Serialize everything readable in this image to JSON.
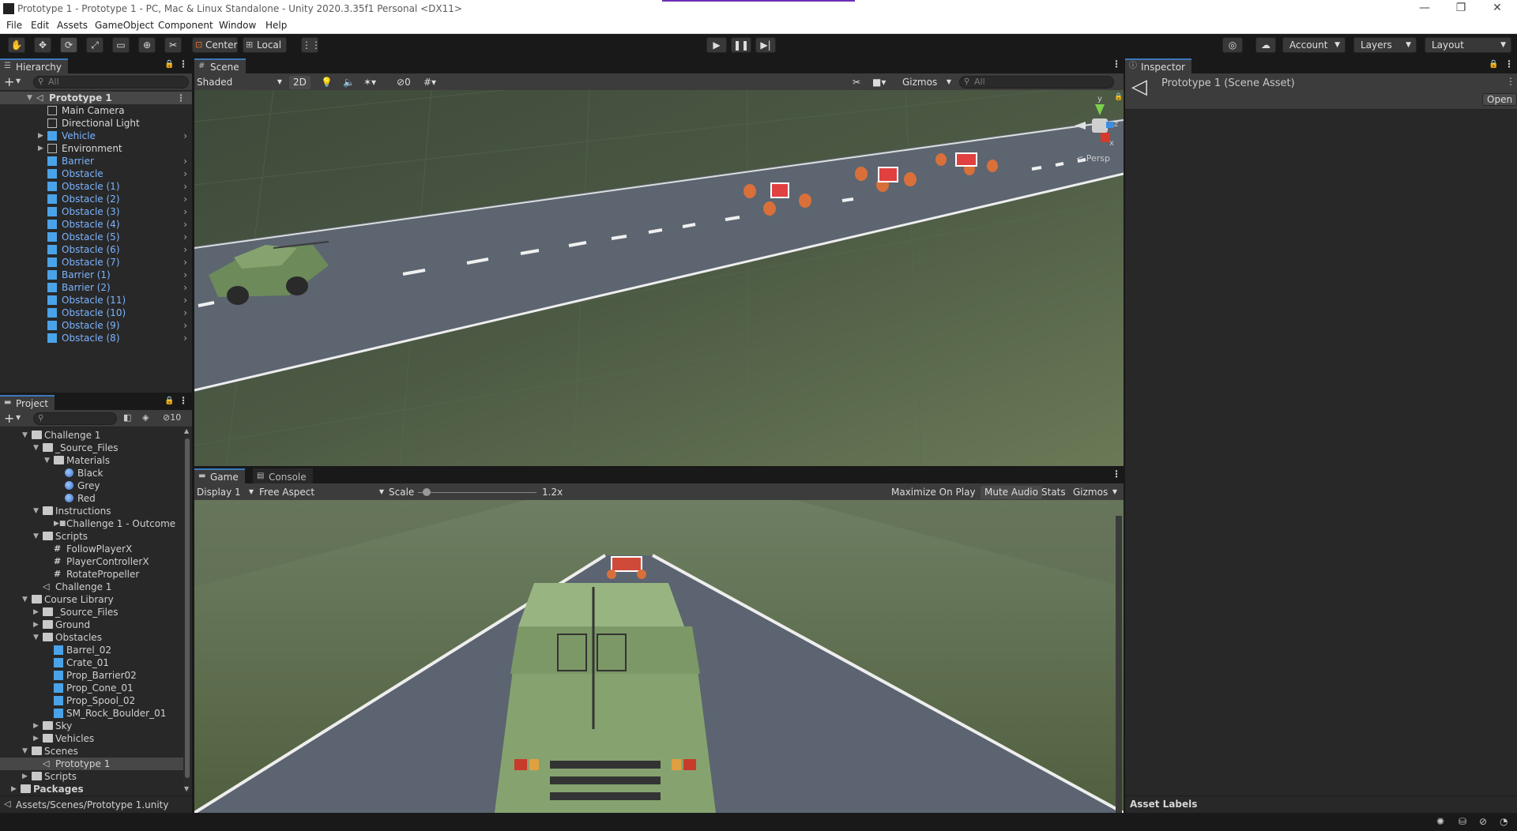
{
  "window": {
    "title": "Prototype 1 - Prototype 1 - PC, Mac & Linux Standalone - Unity 2020.3.35f1 Personal <DX11>",
    "controls": [
      "—",
      "❐",
      "✕"
    ]
  },
  "menu": [
    "File",
    "Edit",
    "Assets",
    "GameObject",
    "Component",
    "Window",
    "Help"
  ],
  "toolbar": {
    "tools": [
      "hand-tool",
      "move-tool",
      "rotate-tool",
      "scale-tool",
      "rect-tool",
      "transform-tool",
      "custom-tool"
    ],
    "pivot": "Center",
    "space": "Local",
    "account": "Account",
    "layers": "Layers",
    "layout": "Layout"
  },
  "hierarchy": {
    "tab": "Hierarchy",
    "search_placeholder": "All",
    "scene": "Prototype 1",
    "items": [
      {
        "label": "Main Camera",
        "blue": false,
        "arrow": false
      },
      {
        "label": "Directional Light",
        "blue": false,
        "arrow": false
      },
      {
        "label": "Vehicle",
        "blue": true,
        "arrow": true
      },
      {
        "label": "Environment",
        "blue": false,
        "arrow": true
      },
      {
        "label": "Barrier",
        "blue": true,
        "arrow": false
      },
      {
        "label": "Obstacle",
        "blue": true,
        "arrow": false
      },
      {
        "label": "Obstacle (1)",
        "blue": true,
        "arrow": false
      },
      {
        "label": "Obstacle (2)",
        "blue": true,
        "arrow": false
      },
      {
        "label": "Obstacle (3)",
        "blue": true,
        "arrow": false
      },
      {
        "label": "Obstacle (4)",
        "blue": true,
        "arrow": false
      },
      {
        "label": "Obstacle (5)",
        "blue": true,
        "arrow": false
      },
      {
        "label": "Obstacle (6)",
        "blue": true,
        "arrow": false
      },
      {
        "label": "Obstacle (7)",
        "blue": true,
        "arrow": false
      },
      {
        "label": "Barrier (1)",
        "blue": true,
        "arrow": false
      },
      {
        "label": "Barrier (2)",
        "blue": true,
        "arrow": false
      },
      {
        "label": "Obstacle (11)",
        "blue": true,
        "arrow": false
      },
      {
        "label": "Obstacle (10)",
        "blue": true,
        "arrow": false
      },
      {
        "label": "Obstacle (9)",
        "blue": true,
        "arrow": false
      },
      {
        "label": "Obstacle (8)",
        "blue": true,
        "arrow": false
      }
    ]
  },
  "project": {
    "tab": "Project",
    "hidden_count": "10",
    "tree": [
      {
        "label": "Challenge 1",
        "indent": 1,
        "type": "folder",
        "arrow": "down"
      },
      {
        "label": "_Source_Files",
        "indent": 2,
        "type": "folder",
        "arrow": "down"
      },
      {
        "label": "Materials",
        "indent": 3,
        "type": "folder",
        "arrow": "down"
      },
      {
        "label": "Black",
        "indent": 4,
        "type": "material",
        "arrow": ""
      },
      {
        "label": "Grey",
        "indent": 4,
        "type": "material",
        "arrow": ""
      },
      {
        "label": "Red",
        "indent": 4,
        "type": "material",
        "arrow": ""
      },
      {
        "label": "Instructions",
        "indent": 2,
        "type": "folder",
        "arrow": "down"
      },
      {
        "label": "Challenge 1 - Outcome",
        "indent": 3,
        "type": "video",
        "arrow": ""
      },
      {
        "label": "Scripts",
        "indent": 2,
        "type": "folder",
        "arrow": "down"
      },
      {
        "label": "FollowPlayerX",
        "indent": 3,
        "type": "script",
        "arrow": ""
      },
      {
        "label": "PlayerControllerX",
        "indent": 3,
        "type": "script",
        "arrow": ""
      },
      {
        "label": "RotatePropeller",
        "indent": 3,
        "type": "script",
        "arrow": ""
      },
      {
        "label": "Challenge 1",
        "indent": 2,
        "type": "scene",
        "arrow": ""
      },
      {
        "label": "Course Library",
        "indent": 1,
        "type": "folder",
        "arrow": "down"
      },
      {
        "label": "_Source_Files",
        "indent": 2,
        "type": "folder",
        "arrow": "right"
      },
      {
        "label": "Ground",
        "indent": 2,
        "type": "folder",
        "arrow": "right"
      },
      {
        "label": "Obstacles",
        "indent": 2,
        "type": "folder",
        "arrow": "down"
      },
      {
        "label": "Barrel_02",
        "indent": 3,
        "type": "prefab",
        "arrow": ""
      },
      {
        "label": "Crate_01",
        "indent": 3,
        "type": "prefab",
        "arrow": ""
      },
      {
        "label": "Prop_Barrier02",
        "indent": 3,
        "type": "prefab",
        "arrow": ""
      },
      {
        "label": "Prop_Cone_01",
        "indent": 3,
        "type": "prefab",
        "arrow": ""
      },
      {
        "label": "Prop_Spool_02",
        "indent": 3,
        "type": "prefab",
        "arrow": ""
      },
      {
        "label": "SM_Rock_Boulder_01",
        "indent": 3,
        "type": "prefab",
        "arrow": ""
      },
      {
        "label": "Sky",
        "indent": 2,
        "type": "folder",
        "arrow": "right"
      },
      {
        "label": "Vehicles",
        "indent": 2,
        "type": "folder",
        "arrow": "right"
      },
      {
        "label": "Scenes",
        "indent": 1,
        "type": "folder",
        "arrow": "down"
      },
      {
        "label": "Prototype 1",
        "indent": 2,
        "type": "scene",
        "arrow": "",
        "selected": true
      },
      {
        "label": "Scripts",
        "indent": 1,
        "type": "folder",
        "arrow": "right"
      },
      {
        "label": "Packages",
        "indent": 0,
        "type": "folder",
        "arrow": "right",
        "bold": true
      }
    ],
    "path": "Assets/Scenes/Prototype 1.unity"
  },
  "scene": {
    "tab": "Scene",
    "shading": "Shaded",
    "mode_2d": "2D",
    "hidden_count": "0",
    "gizmos": "Gizmos",
    "search_placeholder": "All",
    "persp": "< Persp",
    "axes": {
      "y": "y",
      "x": "x",
      "z": "z"
    }
  },
  "game": {
    "tab": "Game",
    "console_tab": "Console",
    "display": "Display 1",
    "aspect": "Free Aspect",
    "scale_label": "Scale",
    "scale_value": "1.2x",
    "scale_fraction": 0.02,
    "maximize": "Maximize On Play",
    "mute": "Mute Audio",
    "stats": "Stats",
    "gizmos": "Gizmos"
  },
  "inspector": {
    "tab": "Inspector",
    "asset_title": "Prototype 1 (Scene Asset)",
    "open": "Open",
    "asset_labels": "Asset Labels"
  }
}
